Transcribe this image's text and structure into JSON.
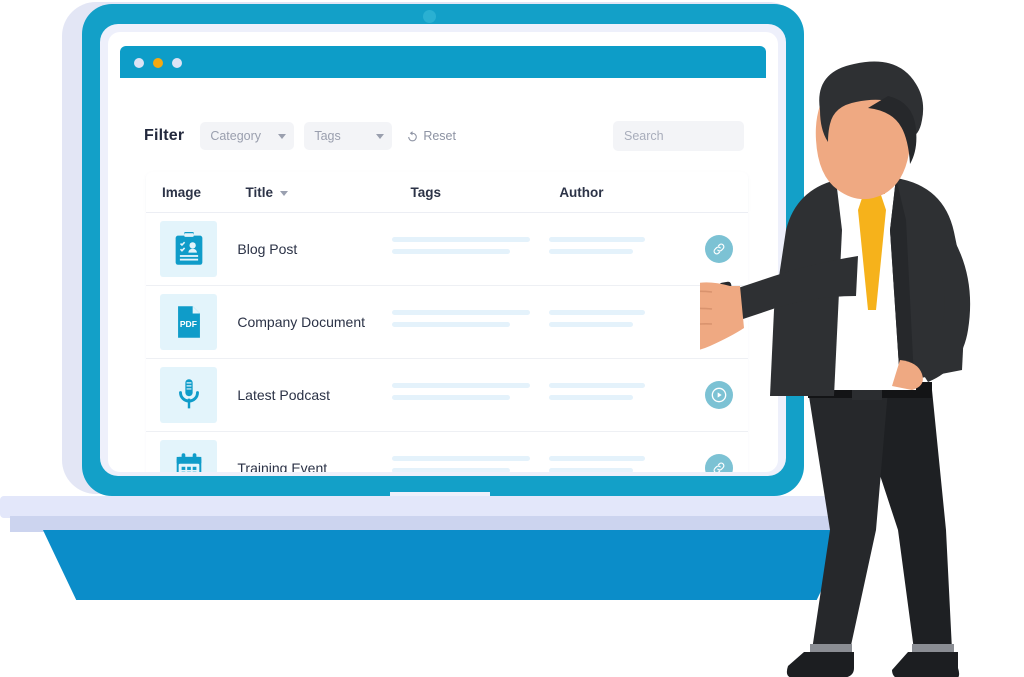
{
  "window": {
    "dots": [
      "window-dot-close",
      "window-dot-minimize",
      "window-dot-maximize"
    ],
    "dot_colors": [
      "#dde3f5",
      "#f5a910",
      "#dde3f5"
    ]
  },
  "filter": {
    "title": "Filter",
    "category_label": "Category",
    "tags_label": "Tags",
    "reset_label": "Reset",
    "search_placeholder": "Search",
    "search_value": ""
  },
  "table": {
    "columns": [
      {
        "key": "image",
        "label": "Image",
        "sortable": false
      },
      {
        "key": "title",
        "label": "Title",
        "sortable": true
      },
      {
        "key": "tags",
        "label": "Tags",
        "sortable": false
      },
      {
        "key": "author",
        "label": "Author",
        "sortable": false
      }
    ],
    "rows": [
      {
        "title": "Blog Post",
        "image_icon": "clipboard-resume-icon",
        "action_icon": "link-icon",
        "tags": "",
        "author": ""
      },
      {
        "title": "Company Document",
        "image_icon": "pdf-file-icon",
        "action_icon": "download-icon",
        "tags": "",
        "author": ""
      },
      {
        "title": "Latest Podcast",
        "image_icon": "microphone-icon",
        "action_icon": "play-icon",
        "tags": "",
        "author": ""
      },
      {
        "title": "Training Event",
        "image_icon": "calendar-icon",
        "action_icon": "link-icon",
        "tags": "",
        "author": ""
      }
    ]
  },
  "colors": {
    "accent_cyan": "#0d9dc8",
    "icon_blue": "#0f9cc9",
    "thumb_bg": "#e3f4fb",
    "action_teal": "#7cc2d4",
    "placeholder_bar": "#e4f2fb",
    "base_blue": "#0b8dc9",
    "lavender": "#e3e7fa",
    "tie_yellow": "#f6b21b",
    "suit_dark": "#2e3033",
    "skin": "#efa982"
  },
  "illustration": {
    "device": "laptop",
    "character": "businessman-pointing"
  }
}
